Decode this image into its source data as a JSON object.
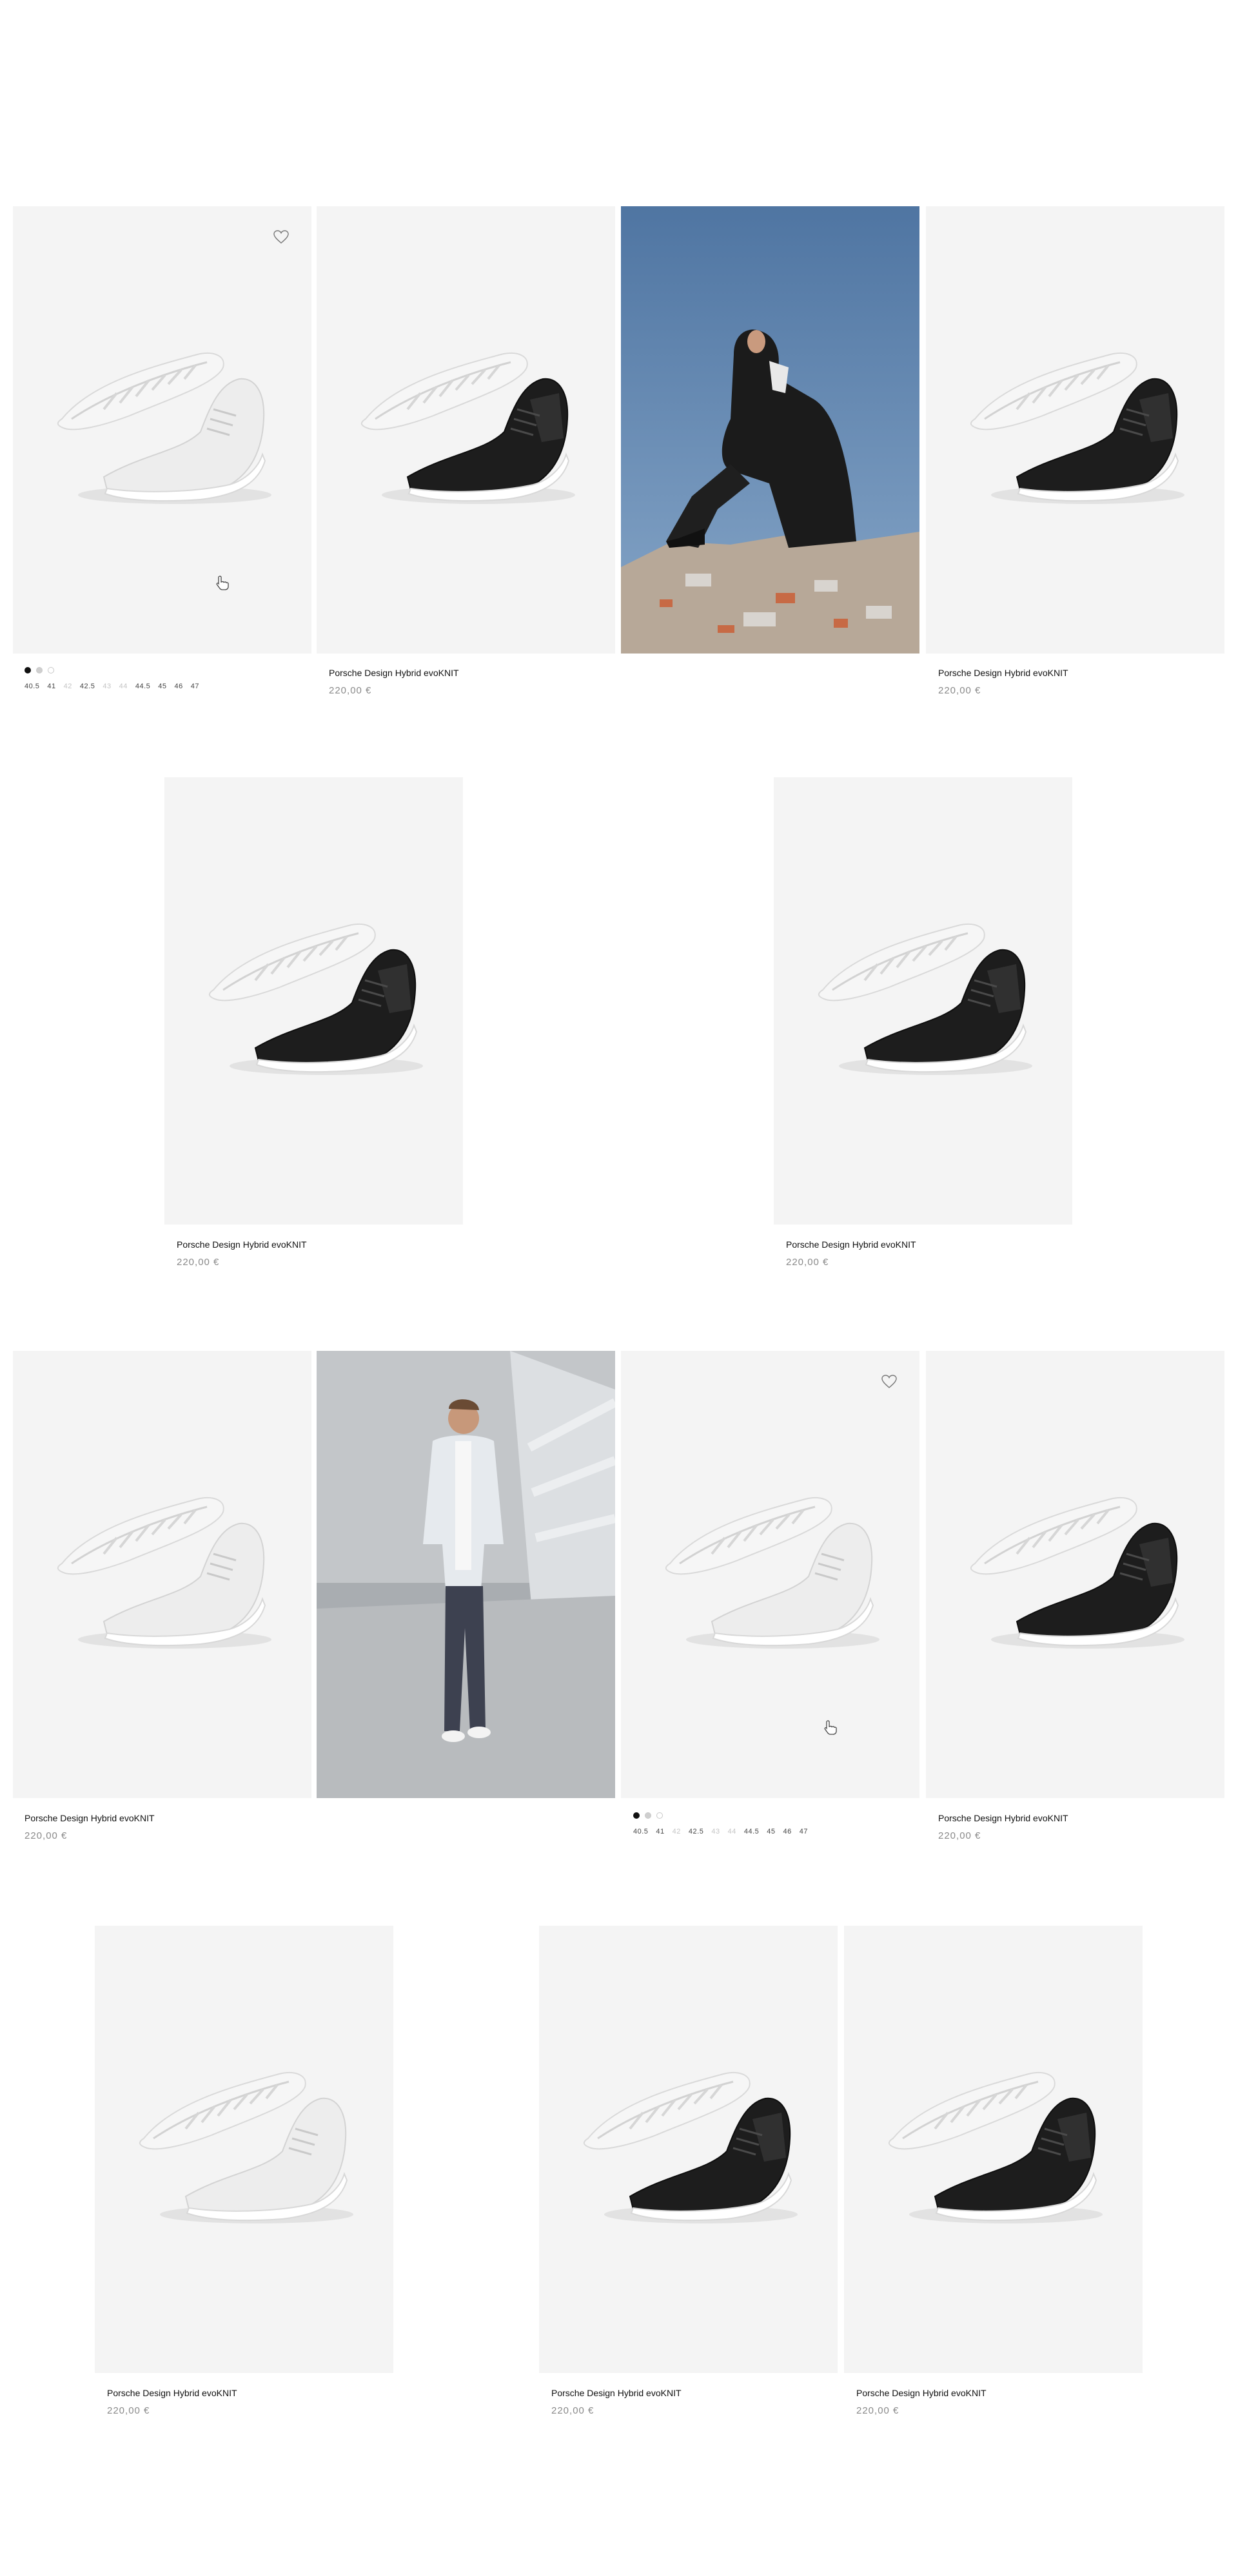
{
  "product": {
    "name": "Porsche Design Hybrid evoKNIT",
    "price": "220,00 €"
  },
  "variants": {
    "swatch_colors": [
      "#111111",
      "#cfcfcf",
      "#ffffff"
    ],
    "sizes": [
      {
        "label": "40.5",
        "available": true
      },
      {
        "label": "41",
        "available": true
      },
      {
        "label": "42",
        "available": false
      },
      {
        "label": "42.5",
        "available": true
      },
      {
        "label": "43",
        "available": false
      },
      {
        "label": "44",
        "available": false
      },
      {
        "label": "44.5",
        "available": true
      },
      {
        "label": "45",
        "available": true
      },
      {
        "label": "46",
        "available": true
      },
      {
        "label": "47",
        "available": true
      }
    ]
  },
  "icons": {
    "wishlist": "heart-outline-icon",
    "pointer": "hand-pointer-icon"
  },
  "colors": {
    "tile_bg": "#f4f4f4",
    "price_text": "#8a8a8a",
    "unavailable_size": "#c4c4c4"
  }
}
